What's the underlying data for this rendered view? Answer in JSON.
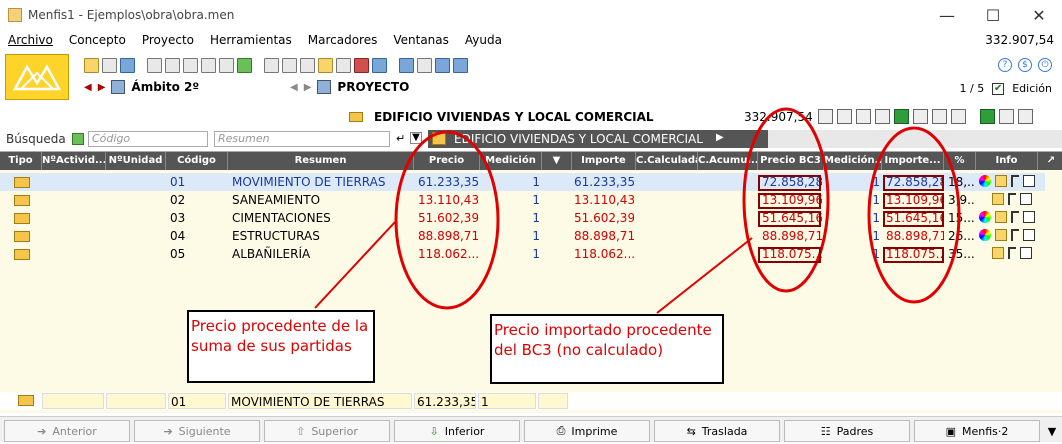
{
  "window": {
    "title": "Menfis1 - Ejemplos\\obra\\obra.men"
  },
  "menu": {
    "items": [
      "Archivo",
      "Concepto",
      "Proyecto",
      "Herramientas",
      "Marcadores",
      "Ventanas",
      "Ayuda"
    ],
    "total": "332.907,54"
  },
  "nav": {
    "ambito": "Ámbito 2º",
    "proyecto": "PROYECTO",
    "pager": "1 / 5",
    "edicion": "Edición"
  },
  "concept": {
    "title": "EDIFICIO VIVIENDAS Y LOCAL COMERCIAL",
    "amount": "332.907,54"
  },
  "search": {
    "label": "Búsqueda",
    "code_placeholder": "Código",
    "summary_placeholder": "Resumen",
    "breadcrumb": "EDIFICIO VIVIENDAS Y LOCAL COMERCIAL"
  },
  "columns": [
    "Tipo",
    "NºActivid...",
    "NºUnidad",
    "Código",
    "Resumen",
    "Precio",
    "Medición",
    "",
    "Importe",
    "C.Calculada",
    "C.Acumul...",
    "Precio BC3",
    "Medición...",
    "Importe...",
    "%",
    "Info"
  ],
  "rows": [
    {
      "code": "01",
      "summary": "MOVIMIENTO DE TIERRAS",
      "price": "61.233,35",
      "med": "1",
      "imp": "61.233,35",
      "pbc3": "72.858,28",
      "med2": "1",
      "imp2": "72.858,28",
      "pct": "18,..."
    },
    {
      "code": "02",
      "summary": "SANEAMIENTO",
      "price": "13.110,43",
      "med": "1",
      "imp": "13.110,43",
      "pbc3": "13.109,96",
      "med2": "1",
      "imp2": "13.109,96",
      "pct": "3,9..."
    },
    {
      "code": "03",
      "summary": "CIMENTACIONES",
      "price": "51.602,39",
      "med": "1",
      "imp": "51.602,39",
      "pbc3": "51.645,16",
      "med2": "1",
      "imp2": "51.645,16",
      "pct": "15..."
    },
    {
      "code": "04",
      "summary": "ESTRUCTURAS",
      "price": "88.898,71",
      "med": "1",
      "imp": "88.898,71",
      "pbc3": "88.898,71",
      "med2": "1",
      "imp2": "88.898,71",
      "pct": "26..."
    },
    {
      "code": "05",
      "summary": "ALBAÑILERÍA",
      "price": "118.062...",
      "med": "1",
      "imp": "118.062...",
      "pbc3": "118.075...",
      "med2": "1",
      "imp2": "118.075...",
      "pct": "35..."
    }
  ],
  "annotations": {
    "left": "Precio procedente de la suma de sus partidas",
    "right": "Precio importado procedente del BC3 (no calculado)"
  },
  "footer": {
    "code": "01",
    "summary": "MOVIMIENTO DE TIERRAS",
    "price": "61.233,35",
    "med": "1"
  },
  "buttons": [
    "Anterior",
    "Siguiente",
    "Superior",
    "Inferior",
    "Imprime",
    "Traslada",
    "Padres",
    "Menfis·2"
  ]
}
